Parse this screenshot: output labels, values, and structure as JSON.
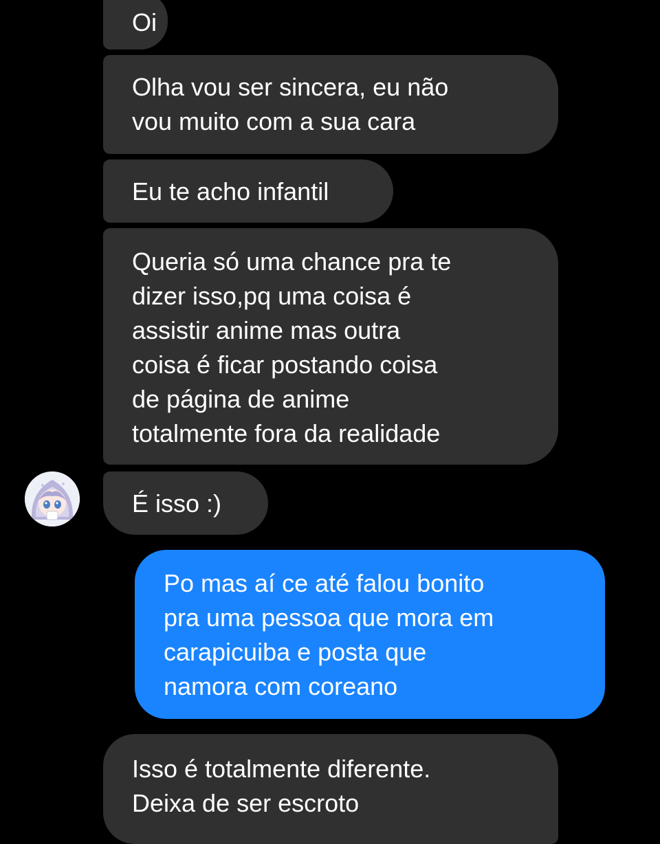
{
  "conversation": {
    "messages": [
      {
        "sender": "them",
        "text": "Oi"
      },
      {
        "sender": "them",
        "text": "Olha vou ser sincera, eu não\nvou muito com a sua cara"
      },
      {
        "sender": "them",
        "text": "Eu te acho infantil"
      },
      {
        "sender": "them",
        "text": "Queria só uma chance pra te\ndizer isso,pq uma coisa é\nassistir anime mas outra\ncoisa é ficar postando coisa\nde página de anime\ntotalmente fora da realidade"
      },
      {
        "sender": "them",
        "text": "É  isso :)"
      },
      {
        "sender": "me",
        "text": "Po mas aí ce até falou bonito\npra uma pessoa que mora em\ncarapicuiba e posta que\nnamora com coreano"
      },
      {
        "sender": "them",
        "text": "Isso é totalmente diferente.\nDeixa de ser escroto"
      }
    ]
  },
  "contact": {
    "avatar_icon": "anime-girl-avatar-icon"
  },
  "colors": {
    "background": "#000000",
    "incoming_bubble": "#303030",
    "outgoing_bubble": "#1a84ff",
    "text": "#ffffff"
  }
}
